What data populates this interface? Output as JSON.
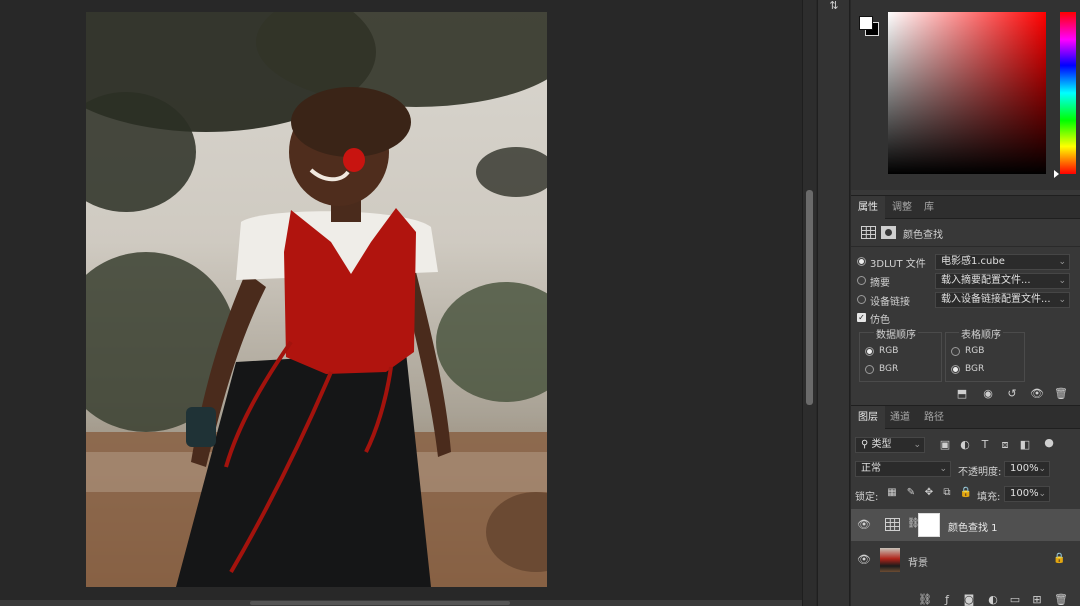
{
  "workspace": {
    "photo_alt": "photo"
  },
  "strip": {
    "icon": "swap-icon"
  },
  "color_panel": {
    "foreground_color": "#ffffff",
    "background_color": "#000000",
    "hue_color": "#ff0000"
  },
  "properties_panel": {
    "tabs": [
      "属性",
      "调整",
      "库"
    ],
    "active_tab": "属性",
    "header_title": "颜色查找",
    "options": {
      "lut_label": "3DLUT 文件",
      "lut_value": "电影感1.cube",
      "abstract_label": "摘要",
      "abstract_value": "载入摘要配置文件...",
      "device_label": "设备链接",
      "device_value": "载入设备链接配置文件...",
      "dither_label": "仿色",
      "dither_checked": true
    },
    "data_order": {
      "title": "数据顺序",
      "rgb": "RGB",
      "bgr": "BGR",
      "selected": "RGB"
    },
    "table_order": {
      "title": "表格顺序",
      "rgb": "RGB",
      "bgr": "BGR",
      "selected": "BGR"
    }
  },
  "layers_panel": {
    "tabs": [
      "图层",
      "通道",
      "路径"
    ],
    "active_tab": "图层",
    "filter_label": "类型",
    "blend_mode": "正常",
    "opacity_label": "不透明度:",
    "opacity_value": "100%",
    "lock_label": "锁定:",
    "fill_label": "填充:",
    "fill_value": "100%",
    "layers": [
      {
        "name": "颜色查找 1",
        "selected": true
      },
      {
        "name": "背景",
        "selected": false,
        "locked": true
      }
    ]
  }
}
